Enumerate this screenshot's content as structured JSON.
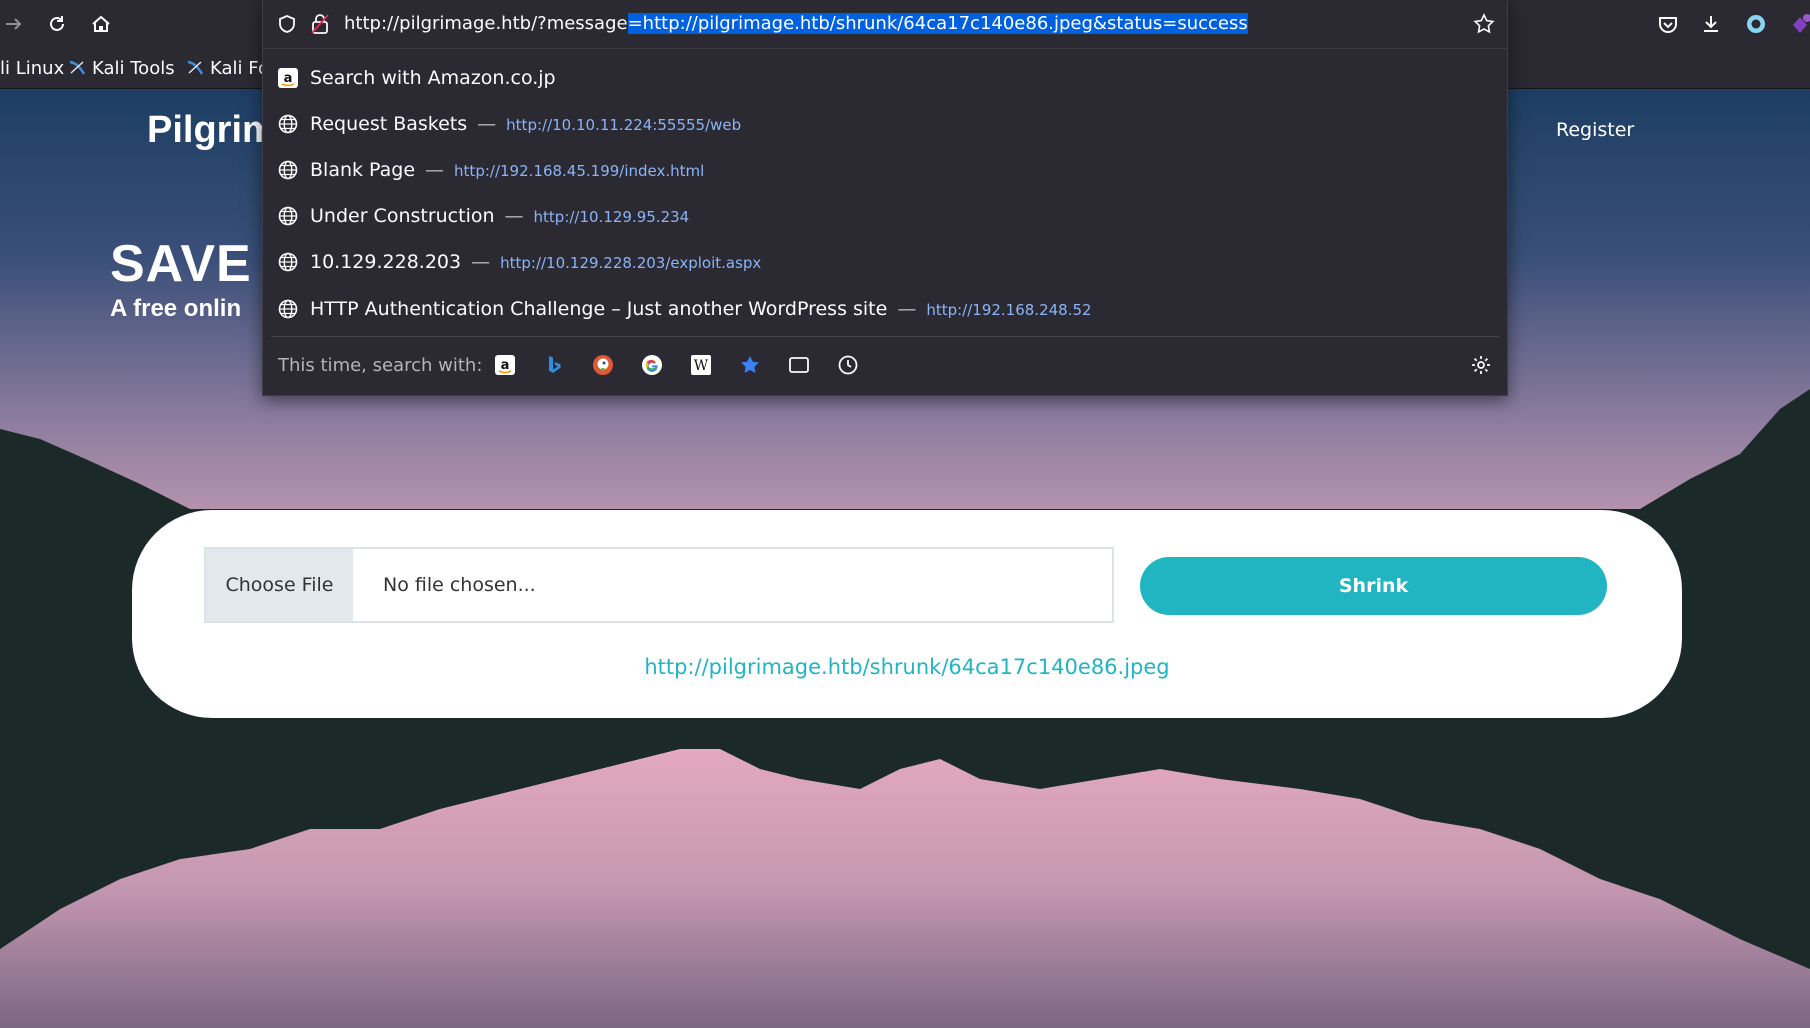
{
  "browser": {
    "url_prefix": "http://pilgrimage.htb/?message",
    "url_selected": "=http://pilgrimage.htb/shrunk/64ca17c140e86.jpeg&status=success",
    "bookmarks": [
      "li Linux",
      "Kali Tools",
      "Kali Fo"
    ]
  },
  "dropdown": {
    "search_row": "Search with Amazon.co.jp",
    "suggestions": [
      {
        "title": "Request Baskets",
        "url": "http://10.10.11.224:55555/web"
      },
      {
        "title": "Blank Page",
        "url": "http://192.168.45.199/index.html"
      },
      {
        "title": "Under Construction",
        "url": "http://10.129.95.234"
      },
      {
        "title": "10.129.228.203",
        "url": "http://10.129.228.203/exploit.aspx"
      },
      {
        "title": "HTTP Authentication Challenge – Just another WordPress site",
        "url": "http://192.168.248.52"
      }
    ],
    "separator": "—",
    "footer_label": "This time, search with:",
    "engines": [
      "amazon-icon",
      "bing-icon",
      "duckduckgo-icon",
      "google-icon",
      "wikipedia-icon",
      "bookmarks-icon",
      "tabs-icon",
      "history-icon"
    ]
  },
  "page": {
    "brand": "Pilgrim",
    "register": "Register",
    "hero_title": "SAVE S",
    "hero_sub": "A free onlin",
    "choose_file": "Choose File",
    "no_file": "No file chosen...",
    "shrink": "Shrink",
    "result_link": "http://pilgrimage.htb/shrunk/64ca17c140e86.jpeg"
  },
  "colors": {
    "accent": "#21b5c2",
    "selection": "#0061e0",
    "link": "#8ab4f8"
  }
}
